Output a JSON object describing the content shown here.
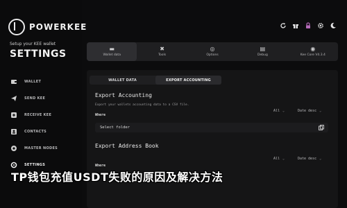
{
  "brand": {
    "name": "POWERKEE"
  },
  "sidebar": {
    "subtitle": "Setup your KEE wallet",
    "title": "SETTINGS",
    "items": [
      {
        "label": "WALLET",
        "icon": "wallet-icon"
      },
      {
        "label": "SEND KEE",
        "icon": "send-icon"
      },
      {
        "label": "RECEIVE KEE",
        "icon": "receive-icon"
      },
      {
        "label": "CONTACTS",
        "icon": "contacts-icon"
      },
      {
        "label": "MASTER NODES",
        "icon": "master-nodes-icon"
      },
      {
        "label": "SETTINGS",
        "icon": "settings-icon"
      }
    ]
  },
  "header": {
    "icons": [
      "refresh-icon",
      "gift-icon",
      "lock-icon",
      "gear-icon",
      "moon-icon"
    ]
  },
  "tabs": [
    {
      "label": "Wallet data",
      "icon": "wallet-data-icon",
      "active": true
    },
    {
      "label": "Tools",
      "icon": "tools-icon",
      "active": false
    },
    {
      "label": "Options",
      "icon": "options-icon",
      "active": false
    },
    {
      "label": "Debug",
      "icon": "debug-icon",
      "active": false
    },
    {
      "label": "Kee Core V4.3.4",
      "icon": "core-icon",
      "active": false
    }
  ],
  "subtabs": [
    {
      "label": "WALLET DATA",
      "active": false
    },
    {
      "label": "EXPORT ACCOUNTING",
      "active": true
    }
  ],
  "export_accounting": {
    "title": "Export Accounting",
    "description": "Export your wallets accounting data to a CSV file.",
    "where_label": "Where",
    "filter_all": "All",
    "sort": "Date desc",
    "field_value": "Select folder"
  },
  "export_address_book": {
    "title": "Export Address Book",
    "where_label": "Where",
    "filter_all": "All",
    "sort": "Date desc"
  },
  "overlay_caption": "TP钱包充值USDT失败的原因及解决方法",
  "colors": {
    "background": "#0c0c0d",
    "panel": "#151516",
    "accent_icon": "#b56ab8"
  }
}
